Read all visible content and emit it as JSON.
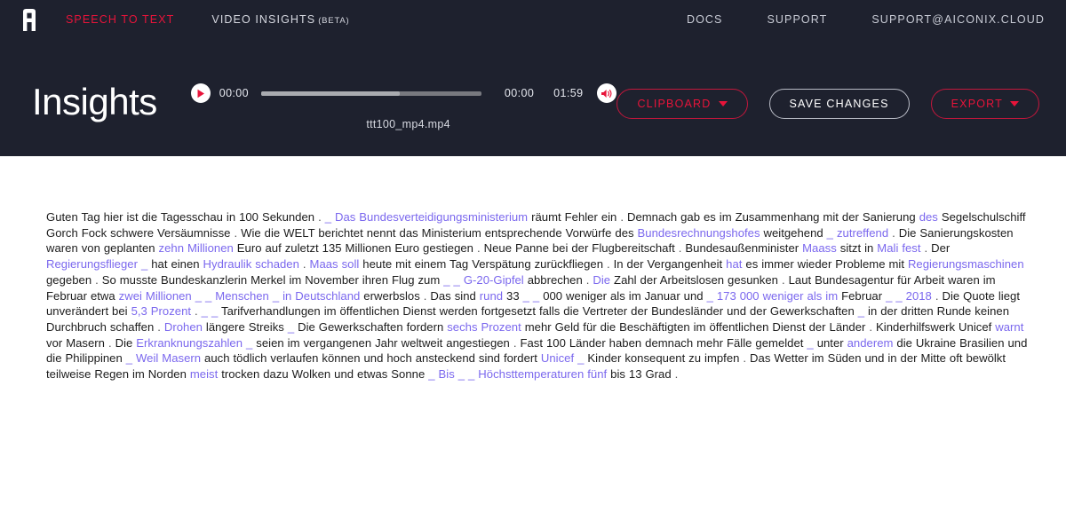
{
  "brand": {
    "logo_letter": "A",
    "accent_color": "#e8143a",
    "entity_color": "#7b68ee",
    "header_bg": "#1e212e"
  },
  "topnav": {
    "left_items": [
      {
        "label": "SPEECH TO TEXT",
        "active": true
      },
      {
        "label": "VIDEO INSIGHTS",
        "badge": "(BETA)",
        "active": false
      }
    ],
    "right_items": [
      {
        "label": "DOCS"
      },
      {
        "label": "SUPPORT"
      },
      {
        "label": "SUPPORT@AICONIX.CLOUD"
      }
    ]
  },
  "header": {
    "page_title": "Insights"
  },
  "player": {
    "play_icon": "play-icon",
    "volume_icon": "volume-on-icon",
    "current_time": "00:00",
    "elapsed_time": "00:00",
    "total_time": "01:59",
    "progress_percent": 63,
    "filename": "ttt100_mp4.mp4"
  },
  "actions": {
    "clipboard_label": "CLIPBOARD",
    "save_label": "SAVE CHANGES",
    "export_label": "EXPORT"
  },
  "transcript": {
    "tokens": [
      {
        "t": "Guten Tag hier ist die Tagesschau in 100 Sekunden",
        "k": "plain"
      },
      {
        "t": ".",
        "k": "pun"
      },
      {
        "t": "_",
        "k": "ent"
      },
      {
        "t": "Das Bundesverteidigungsministerium",
        "k": "ent"
      },
      {
        "t": "räumt Fehler ein",
        "k": "plain"
      },
      {
        "t": ".",
        "k": "pun"
      },
      {
        "t": "Demnach gab es im Zusammenhang mit der Sanierung",
        "k": "plain"
      },
      {
        "t": "des",
        "k": "ent"
      },
      {
        "t": "Segelschulschiff Gorch Fock schwere Versäumnisse",
        "k": "plain"
      },
      {
        "t": ".",
        "k": "pun"
      },
      {
        "t": "Wie die WELT berichtet nennt das Ministerium entsprechende Vorwürfe des",
        "k": "plain"
      },
      {
        "t": "Bundesrechnungshofes",
        "k": "ent"
      },
      {
        "t": "weitgehend",
        "k": "plain"
      },
      {
        "t": "_",
        "k": "ent"
      },
      {
        "t": "zutreffend",
        "k": "ent"
      },
      {
        "t": ".",
        "k": "pun"
      },
      {
        "t": "Die Sanierungskosten waren von geplanten",
        "k": "plain"
      },
      {
        "t": "zehn Millionen",
        "k": "ent"
      },
      {
        "t": "Euro auf zuletzt 135 Millionen Euro gestiegen",
        "k": "plain"
      },
      {
        "t": ".",
        "k": "pun"
      },
      {
        "t": "Neue Panne bei der Flugbereitschaft",
        "k": "plain"
      },
      {
        "t": ".",
        "k": "pun"
      },
      {
        "t": "Bundesaußenminister",
        "k": "plain"
      },
      {
        "t": "Maass",
        "k": "ent"
      },
      {
        "t": "sitzt in",
        "k": "plain"
      },
      {
        "t": "Mali fest",
        "k": "ent"
      },
      {
        "t": ".",
        "k": "pun"
      },
      {
        "t": "Der",
        "k": "plain"
      },
      {
        "t": "Regierungsflieger",
        "k": "ent"
      },
      {
        "t": "_",
        "k": "ent"
      },
      {
        "t": "hat einen",
        "k": "plain"
      },
      {
        "t": "Hydraulik schaden",
        "k": "ent"
      },
      {
        "t": ".",
        "k": "pun"
      },
      {
        "t": "Maas soll",
        "k": "ent"
      },
      {
        "t": "heute mit einem Tag Verspätung zurückfliegen",
        "k": "plain"
      },
      {
        "t": ".",
        "k": "pun"
      },
      {
        "t": "In der Vergangenheit",
        "k": "plain"
      },
      {
        "t": "hat",
        "k": "ent"
      },
      {
        "t": "es immer wieder Probleme mit",
        "k": "plain"
      },
      {
        "t": "Regierungsmaschinen",
        "k": "ent"
      },
      {
        "t": "gegeben",
        "k": "plain"
      },
      {
        "t": ".",
        "k": "pun"
      },
      {
        "t": "So musste Bundeskanzlerin Merkel im November ihren Flug zum",
        "k": "plain"
      },
      {
        "t": "_",
        "k": "ent"
      },
      {
        "t": "_",
        "k": "ent"
      },
      {
        "t": "G-20-Gipfel",
        "k": "ent"
      },
      {
        "t": "abbrechen",
        "k": "plain"
      },
      {
        "t": ".",
        "k": "pun"
      },
      {
        "t": "Die",
        "k": "ent"
      },
      {
        "t": "Zahl der Arbeitslosen gesunken",
        "k": "plain"
      },
      {
        "t": ".",
        "k": "pun"
      },
      {
        "t": "Laut Bundesagentur für Arbeit waren im Februar etwa",
        "k": "plain"
      },
      {
        "t": "zwei Millionen",
        "k": "ent"
      },
      {
        "t": "_",
        "k": "ent"
      },
      {
        "t": "_",
        "k": "ent"
      },
      {
        "t": "Menschen",
        "k": "ent"
      },
      {
        "t": "_",
        "k": "ent"
      },
      {
        "t": "in Deutschland",
        "k": "ent"
      },
      {
        "t": "erwerbslos",
        "k": "plain"
      },
      {
        "t": ".",
        "k": "pun"
      },
      {
        "t": "Das sind",
        "k": "plain"
      },
      {
        "t": "rund",
        "k": "ent"
      },
      {
        "t": "33",
        "k": "plain"
      },
      {
        "t": "_",
        "k": "ent"
      },
      {
        "t": "_",
        "k": "ent"
      },
      {
        "t": "000 weniger als im Januar und",
        "k": "plain"
      },
      {
        "t": "_",
        "k": "ent"
      },
      {
        "t": "173 000 weniger als im",
        "k": "ent"
      },
      {
        "t": "Februar",
        "k": "plain"
      },
      {
        "t": "_",
        "k": "ent"
      },
      {
        "t": "_",
        "k": "ent"
      },
      {
        "t": "2018",
        "k": "ent"
      },
      {
        "t": ".",
        "k": "pun"
      },
      {
        "t": "Die Quote liegt unverändert bei",
        "k": "plain"
      },
      {
        "t": "5,3 Prozent",
        "k": "ent"
      },
      {
        "t": ".",
        "k": "pun"
      },
      {
        "t": "_",
        "k": "ent"
      },
      {
        "t": "_",
        "k": "ent"
      },
      {
        "t": "Tarifverhandlungen im öffentlichen Dienst werden fortgesetzt falls die Vertreter der Bundesländer und der Gewerkschaften",
        "k": "plain"
      },
      {
        "t": "_",
        "k": "ent"
      },
      {
        "t": "in der dritten Runde keinen Durchbruch schaffen",
        "k": "plain"
      },
      {
        "t": ".",
        "k": "pun"
      },
      {
        "t": "Drohen",
        "k": "ent"
      },
      {
        "t": "längere Streiks",
        "k": "plain"
      },
      {
        "t": "_",
        "k": "ent"
      },
      {
        "t": "Die Gewerkschaften fordern",
        "k": "plain"
      },
      {
        "t": "sechs Prozent",
        "k": "ent"
      },
      {
        "t": "mehr Geld für die Beschäftigten im öffentlichen Dienst der Länder",
        "k": "plain"
      },
      {
        "t": ".",
        "k": "pun"
      },
      {
        "t": "Kinderhilfswerk Unicef",
        "k": "plain"
      },
      {
        "t": "warnt",
        "k": "ent"
      },
      {
        "t": "vor Masern",
        "k": "plain"
      },
      {
        "t": ".",
        "k": "pun"
      },
      {
        "t": "Die",
        "k": "plain"
      },
      {
        "t": "Erkranknungszahlen",
        "k": "ent"
      },
      {
        "t": "_",
        "k": "ent"
      },
      {
        "t": "seien im vergangenen Jahr weltweit angestiegen",
        "k": "plain"
      },
      {
        "t": ".",
        "k": "pun"
      },
      {
        "t": "Fast 100 Länder haben demnach mehr Fälle gemeldet",
        "k": "plain"
      },
      {
        "t": "_",
        "k": "ent"
      },
      {
        "t": "unter",
        "k": "plain"
      },
      {
        "t": "anderem",
        "k": "ent"
      },
      {
        "t": "die Ukraine Brasilien und die Philippinen",
        "k": "plain"
      },
      {
        "t": "_",
        "k": "ent"
      },
      {
        "t": "Weil Masern",
        "k": "ent"
      },
      {
        "t": "auch tödlich verlaufen können und hoch ansteckend sind fordert",
        "k": "plain"
      },
      {
        "t": "Unicef",
        "k": "ent"
      },
      {
        "t": "_",
        "k": "ent"
      },
      {
        "t": "Kinder konsequent zu impfen",
        "k": "plain"
      },
      {
        "t": ".",
        "k": "pun"
      },
      {
        "t": "Das Wetter im Süden und in der Mitte oft bewölkt teilweise Regen im Norden",
        "k": "plain"
      },
      {
        "t": "meist",
        "k": "ent"
      },
      {
        "t": "trocken dazu Wolken und etwas Sonne",
        "k": "plain"
      },
      {
        "t": "_",
        "k": "ent"
      },
      {
        "t": "Bis",
        "k": "ent"
      },
      {
        "t": "_",
        "k": "ent"
      },
      {
        "t": "_",
        "k": "ent"
      },
      {
        "t": "Höchsttemperaturen fünf",
        "k": "ent"
      },
      {
        "t": "bis 13 Grad",
        "k": "plain"
      },
      {
        "t": ".",
        "k": "pun"
      }
    ]
  }
}
